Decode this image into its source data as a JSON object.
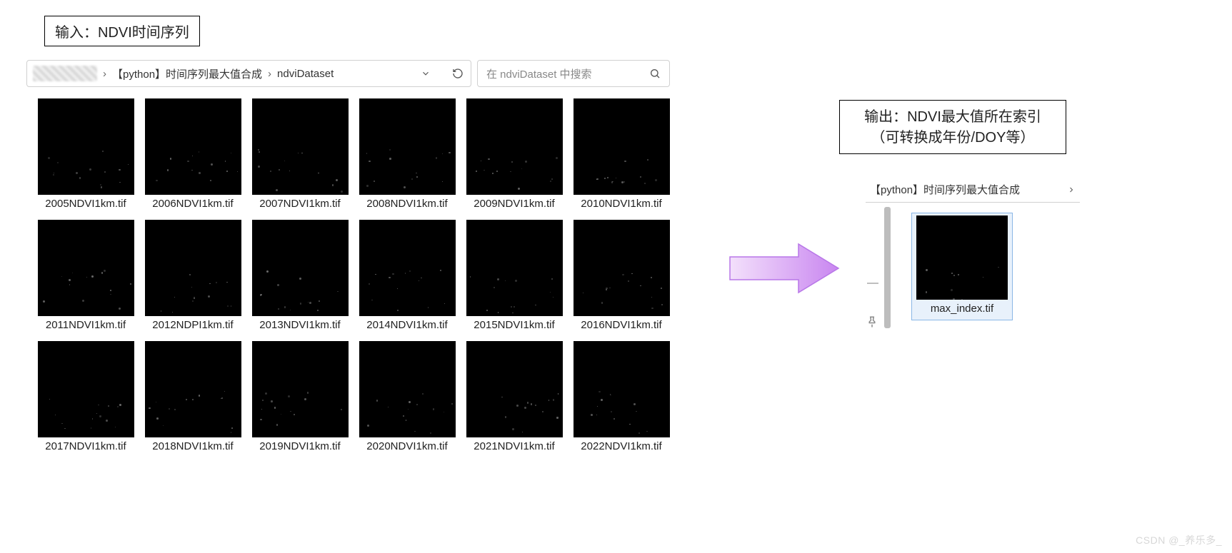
{
  "input_label": "输入：NDVI时间序列",
  "output_label_line1": "输出：NDVI最大值所在索引",
  "output_label_line2": "（可转换成年份/DOY等）",
  "left_explorer": {
    "breadcrumb": {
      "segment1": "【python】时间序列最大值合成",
      "segment2": "ndviDataset"
    },
    "search_placeholder": "在 ndviDataset 中搜索",
    "files": [
      "2005NDVI1km.tif",
      "2006NDVI1km.tif",
      "2007NDVI1km.tif",
      "2008NDVI1km.tif",
      "2009NDVI1km.tif",
      "2010NDVI1km.tif",
      "2011NDVI1km.tif",
      "2012NDPI1km.tif",
      "2013NDVI1km.tif",
      "2014NDVI1km.tif",
      "2015NDVI1km.tif",
      "2016NDVI1km.tif",
      "2017NDVI1km.tif",
      "2018NDVI1km.tif",
      "2019NDVI1km.tif",
      "2020NDVI1km.tif",
      "2021NDVI1km.tif",
      "2022NDVI1km.tif"
    ]
  },
  "right_explorer": {
    "breadcrumb": "【python】时间序列最大值合成",
    "file": "max_index.tif"
  },
  "watermark": "CSDN @_养乐多_"
}
